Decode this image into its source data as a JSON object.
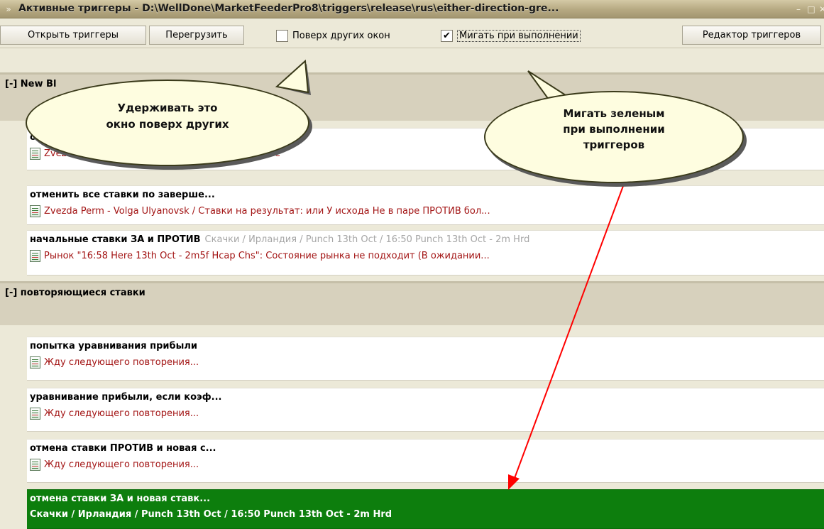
{
  "window": {
    "title": "Активные триггеры - D:\\WellDone\\MarketFeederPro8\\triggers\\release\\rus\\either-direction-gre...",
    "minimize_glyph": "–",
    "maximize_glyph": "□",
    "close_glyph": "✕"
  },
  "toolbar": {
    "open_triggers_label": "Открыть триггеры",
    "reload_label": "Перегрузить",
    "on_top_label": "Поверх других окон",
    "on_top_checked": false,
    "flash_label": "Мигать при выполнении",
    "flash_checked": true,
    "flash_check_glyph": "✔",
    "editor_label": "Редактор триггеров"
  },
  "groups": [
    {
      "title": "[-] New Bl",
      "items": [
        {
          "name": "от",
          "status": "Zvezda                             vsk / Ставки на результат:  и У исхода Не"
        },
        {
          "name": "отменить все ставки по заверше...",
          "status": "Zvezda Perm - Volga Ulyanovsk / Ставки на результат:  или У исхода Не в паре ПРОТИВ бол..."
        },
        {
          "name": "начальные ставки ЗА и ПРОТИВ",
          "info": "Скачки / Ирландия / Punch  13th Oct / 16:50 Punch  13th Oct - 2m Hrd",
          "status": "Рынок \"16:58 Here  13th Oct - 2m5f Hcap Chs\": Состояние рынка не подходит (В ожидании..."
        }
      ]
    },
    {
      "title": "[-] повторяющиеся ставки",
      "items": [
        {
          "name": "попытка уравнивания прибыли",
          "status": "Жду следующего повторения..."
        },
        {
          "name": "уравнивание прибыли, если коэф...",
          "status": "Жду следующего повторения..."
        },
        {
          "name": "отмена ставки ПРОТИВ и новая с...",
          "status": "Жду следующего повторения..."
        },
        {
          "name": "отмена ставки ЗА и новая ставк...",
          "status": "Скачки / Ирландия / Punch  13th Oct / 16:50 Punch  13th Oct - 2m Hrd",
          "active": true
        }
      ]
    }
  ],
  "callouts": {
    "on_top": {
      "line1": "Удерживать это",
      "line2": "окно поверх других"
    },
    "flash": {
      "line1": "Мигать зеленым",
      "line2": "при выполнении",
      "line3": "триггеров"
    }
  },
  "colors": {
    "status_text": "#a31515",
    "active_row": "#0d7e0d",
    "group_header": "#d7d1bd",
    "arrow": "#ff0000",
    "callout_fill": "#fefde0"
  }
}
